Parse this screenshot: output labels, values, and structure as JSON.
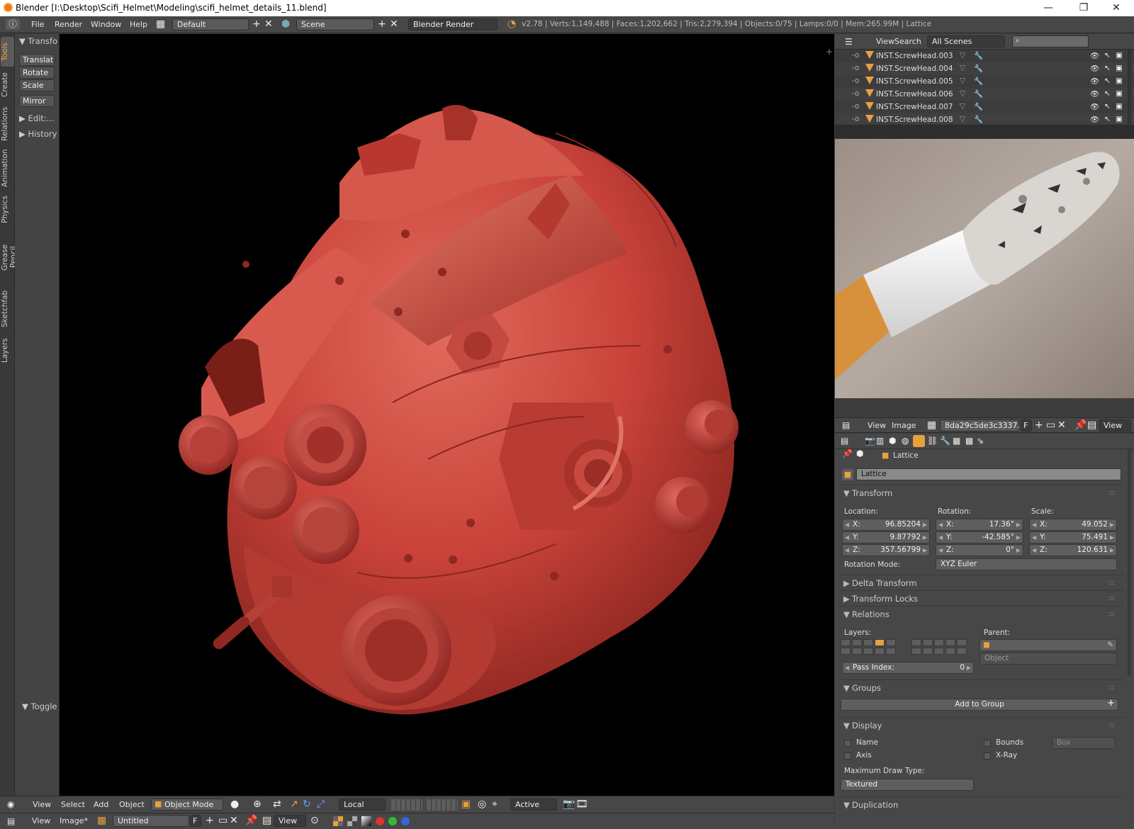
{
  "window": {
    "title": "Blender [I:\\Desktop\\Scifi_Helmet\\Modeling\\scifi_helmet_details_11.blend]",
    "controls": [
      "—",
      "❐",
      "✕"
    ]
  },
  "topbar": {
    "menus": [
      "File",
      "Render",
      "Window",
      "Help"
    ],
    "screen_layout": "Default",
    "scene": "Scene",
    "render_engine": "Blender Render",
    "status": "v2.78 | Verts:1,149,488 | Faces:1,202,662 | Tris:2,279,394 | Objects:0/75 | Lamps:0/0 | Mem:265.99M | Lattice"
  },
  "left_tabs": [
    "Tools",
    "Create",
    "Relations",
    "Animation",
    "Physics",
    "Grease Pencil",
    "Sketchfab",
    "Layers"
  ],
  "tool_shelf": {
    "transform_header": "Transfo",
    "buttons": [
      "Translat",
      "Rotate",
      "Scale",
      "Mirror"
    ],
    "edit_header": "Edit:...",
    "history_header": "History",
    "toggle_edit": "Toggle Edit"
  },
  "viewport_header": {
    "menus": [
      "View",
      "Select",
      "Add",
      "Object"
    ],
    "mode": "Object Mode",
    "orientation": "Local",
    "pivot_snap": "Active"
  },
  "image_editor_header": {
    "menus": [
      "View",
      "Image*"
    ],
    "image_name": "Untitled",
    "fake_user": "F",
    "view_label": "View"
  },
  "outliner": {
    "menus": [
      "View",
      "Search"
    ],
    "scope": "All Scenes",
    "rows": [
      "INST.ScrewHead.003",
      "INST.ScrewHead.004",
      "INST.ScrewHead.005",
      "INST.ScrewHead.006",
      "INST.ScrewHead.007",
      "INST.ScrewHead.008"
    ]
  },
  "image_view_header": {
    "menus": [
      "View",
      "Image"
    ],
    "image_name": "8da29c5de3c3337...",
    "fake_user": "F",
    "view_label": "View"
  },
  "properties": {
    "breadcrumb": "Lattice",
    "object_name": "Lattice",
    "transform": {
      "header": "Transform",
      "location_label": "Location:",
      "rotation_label": "Rotation:",
      "scale_label": "Scale:",
      "location": {
        "x": "96.85204",
        "y": "9.87792",
        "z": "357.56799"
      },
      "rotation": {
        "x": "17.36°",
        "y": "-42.585°",
        "z": "0°"
      },
      "scale": {
        "x": "49.052",
        "y": "75.491",
        "z": "120.631"
      },
      "rotation_mode_label": "Rotation Mode:",
      "rotation_mode": "XYZ Euler"
    },
    "delta_transform": "Delta Transform",
    "transform_locks": "Transform Locks",
    "relations": {
      "header": "Relations",
      "layers_label": "Layers:",
      "parent_label": "Parent:",
      "parent_type": "Object",
      "pass_index_label": "Pass Index:",
      "pass_index": "0"
    },
    "groups": {
      "header": "Groups",
      "add_button": "Add to Group"
    },
    "display": {
      "header": "Display",
      "name": "Name",
      "axis": "Axis",
      "bounds": "Bounds",
      "bounds_type": "Box",
      "xray": "X-Ray",
      "max_draw_label": "Maximum Draw Type:",
      "max_draw_type": "Textured"
    },
    "duplication": "Duplication"
  },
  "axis_letters": {
    "x": "X:",
    "y": "Y:",
    "z": "Z:"
  },
  "colors": {
    "accent_orange": "#e8a040",
    "helmet_red": "#c9433a",
    "panel_bg": "#474747",
    "viewport_bg": "#000000"
  }
}
